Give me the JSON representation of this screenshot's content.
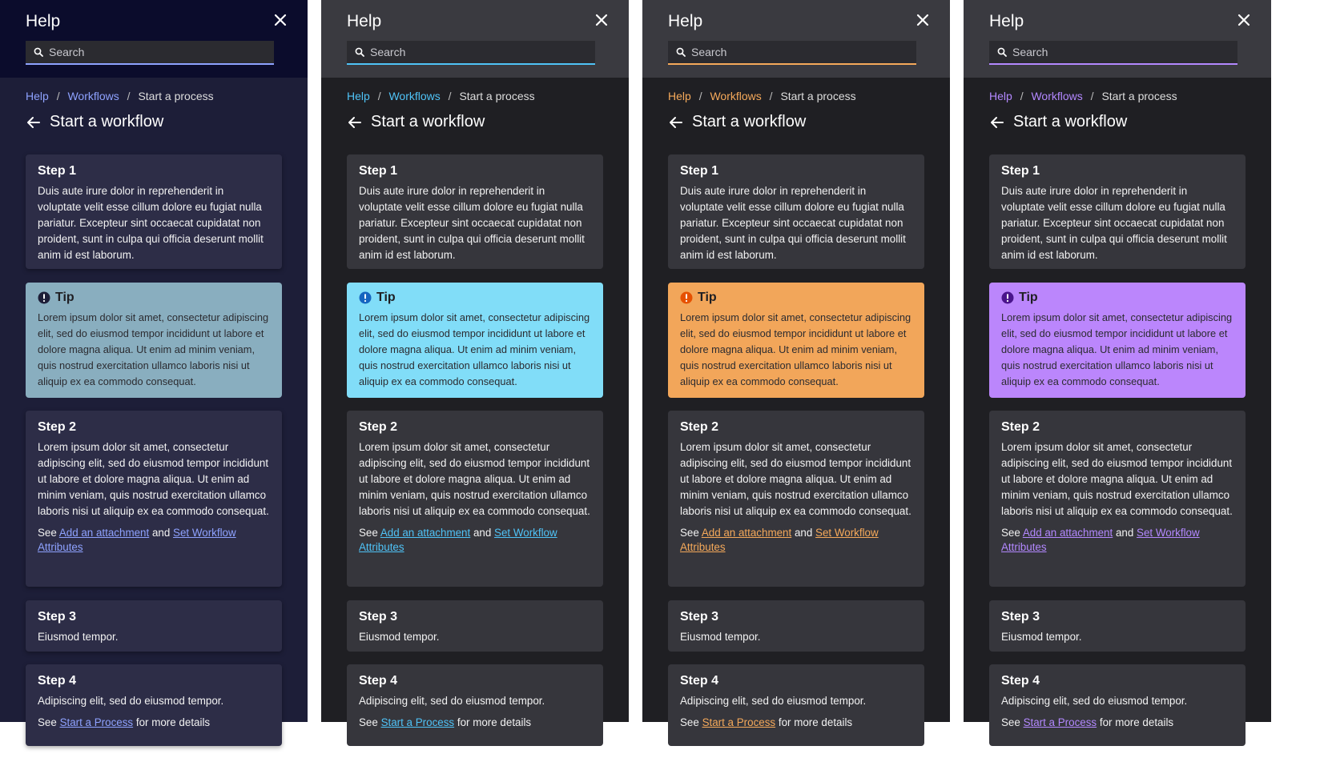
{
  "help": {
    "title": "Help",
    "search_placeholder": "Search",
    "breadcrumb": [
      "Help",
      "Workflows",
      "Start a process"
    ],
    "page_title": "Start a workflow",
    "step1": {
      "title": "Step 1",
      "body": "Duis aute irure dolor in reprehenderit in voluptate velit esse cillum dolore eu fugiat nulla pariatur. Excepteur sint occaecat cupidatat non proident, sunt in culpa qui officia deserunt mollit anim id est laborum."
    },
    "tip": {
      "title": "Tip",
      "body": "Lorem ipsum dolor sit amet, consectetur adipiscing elit, sed do eiusmod tempor incididunt ut labore et dolore magna aliqua. Ut enim ad minim veniam, quis nostrud exercitation ullamco laboris nisi ut aliquip ex ea commodo consequat."
    },
    "step2": {
      "title": "Step 2",
      "body": "Lorem ipsum dolor sit amet, consectetur adipiscing elit, sed do eiusmod tempor incididunt ut labore et dolore magna aliqua. Ut enim ad minim veniam, quis nostrud exercitation ullamco laboris nisi ut aliquip ex ea commodo consequat.",
      "see_prefix": "See",
      "link1": "Add an attachment",
      "and": "and",
      "link2": "Set Workflow Attributes"
    },
    "step3": {
      "title": "Step 3",
      "body": "Eiusmod tempor."
    },
    "step4": {
      "title": "Step 4",
      "body": "Adipiscing elit, sed do eiusmod tempor.",
      "see_prefix": "See",
      "link": "Start a Process",
      "suffix": "for more details"
    }
  },
  "themes": [
    {
      "name": "navy",
      "panel_bg": "#1d1e38",
      "header_bg": "#0b0c2c",
      "card_bg": "#2d2d47",
      "accent": "#8ea2ff",
      "tip_bg": "#89aebf",
      "tip_icon": "#1d1e38"
    },
    {
      "name": "cyan",
      "panel_bg": "#1f1f23",
      "header_bg": "#3a3a40",
      "card_bg": "#36363c",
      "accent": "#4fc3f7",
      "tip_bg": "#81ddf8",
      "tip_icon": "#1565c0"
    },
    {
      "name": "orange",
      "panel_bg": "#1f1f23",
      "header_bg": "#3a3a40",
      "card_bg": "#36363c",
      "accent": "#f5a95a",
      "tip_bg": "#f2a65a",
      "tip_icon": "#e65100"
    },
    {
      "name": "purple",
      "panel_bg": "#1f1f23",
      "header_bg": "#3a3a40",
      "card_bg": "#36363c",
      "accent": "#b388ff",
      "tip_bg": "#bb86fc",
      "tip_icon": "#4a148c"
    }
  ]
}
